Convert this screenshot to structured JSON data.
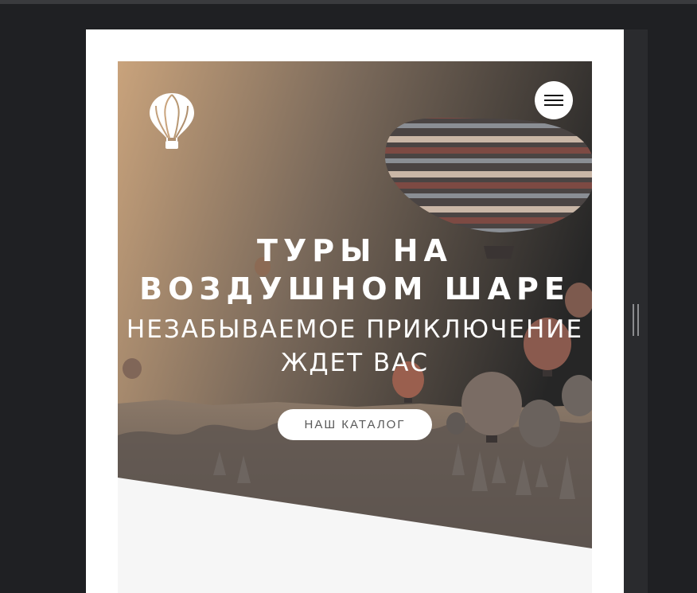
{
  "hero": {
    "title": "ТУРЫ НА ВОЗДУШНОМ ШАРЕ",
    "subtitle": "НЕЗАБЫВАЕМОЕ ПРИКЛЮЧЕНИЕ ЖДЕТ ВАС",
    "cta_label": "НАШ КАТАЛОГ"
  },
  "icons": {
    "logo": "hot-air-balloon-icon",
    "menu": "hamburger-menu-icon"
  },
  "colors": {
    "editor_background": "#1f2023",
    "page_background": "#ffffff",
    "hero_overlay_warm": "#c9a37c",
    "section_background": "#f6f6f6",
    "text": "#ffffff",
    "button_text": "#5a5a5a"
  }
}
